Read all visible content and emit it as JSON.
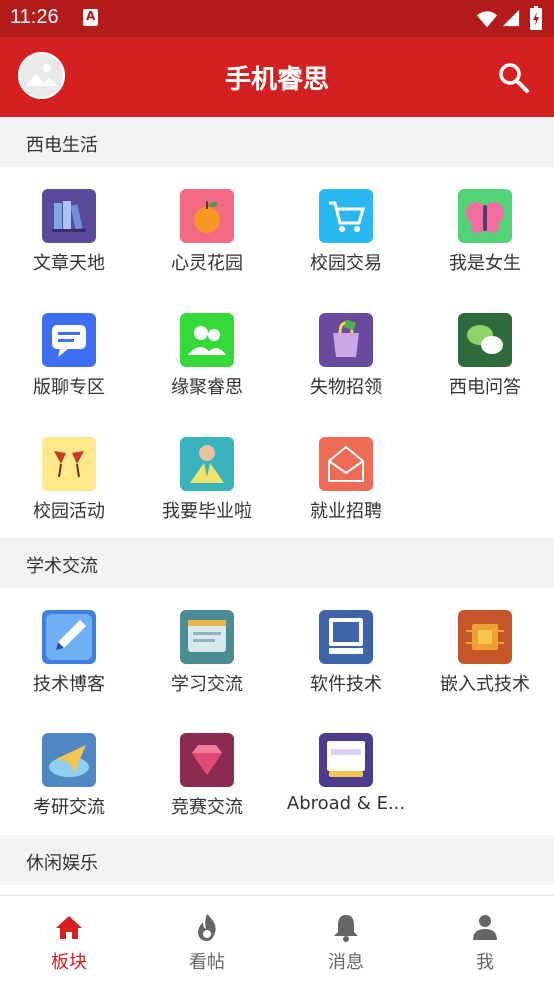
{
  "status_bar": {
    "time": "11:26"
  },
  "app_bar": {
    "title": "手机睿思"
  },
  "sections": [
    {
      "title": "西电生活",
      "items": [
        {
          "label": "文章天地",
          "icon": "bookshelf-icon",
          "color": "#5b4a9c"
        },
        {
          "label": "心灵花园",
          "icon": "apple-icon",
          "color": "#f26a83"
        },
        {
          "label": "校园交易",
          "icon": "shopping-cart-icon",
          "color": "#2bb8f0"
        },
        {
          "label": "我是女生",
          "icon": "butterfly-icon",
          "color": "#55d37a"
        },
        {
          "label": "版聊专区",
          "icon": "chat-bubble-icon",
          "color": "#3d6ff0"
        },
        {
          "label": "缘聚睿思",
          "icon": "people-icon",
          "color": "#36d93a"
        },
        {
          "label": "失物招领",
          "icon": "shopping-bag-icon",
          "color": "#6a4a9c"
        },
        {
          "label": "西电问答",
          "icon": "wechat-icon",
          "color": "#2e6b3a"
        },
        {
          "label": "校园活动",
          "icon": "cheers-icon",
          "color": "#fde98a"
        },
        {
          "label": "我要毕业啦",
          "icon": "graduate-icon",
          "color": "#3ab3bf"
        },
        {
          "label": "就业招聘",
          "icon": "envelope-icon",
          "color": "#ee6b55"
        }
      ]
    },
    {
      "title": "学术交流",
      "items": [
        {
          "label": "技术博客",
          "icon": "pencil-icon",
          "color": "#3f7fe0"
        },
        {
          "label": "学习交流",
          "icon": "browser-window-icon",
          "color": "#4a8c93"
        },
        {
          "label": "软件技术",
          "icon": "computer-icon",
          "color": "#3c64a7"
        },
        {
          "label": "嵌入式技术",
          "icon": "chip-icon",
          "color": "#c4562a"
        },
        {
          "label": "考研交流",
          "icon": "paper-plane-icon",
          "color": "#4f88c5"
        },
        {
          "label": "竞赛交流",
          "icon": "diamond-icon",
          "color": "#8c2a52"
        },
        {
          "label": "Abroad & E...",
          "icon": "english-book-icon",
          "color": "#4e3b8c"
        }
      ]
    },
    {
      "title": "休闲娱乐",
      "items": []
    }
  ],
  "bottom_nav": [
    {
      "label": "板块",
      "icon": "home-icon",
      "active": true
    },
    {
      "label": "看帖",
      "icon": "flame-icon",
      "active": false
    },
    {
      "label": "消息",
      "icon": "bell-icon",
      "active": false
    },
    {
      "label": "我",
      "icon": "person-icon",
      "active": false
    }
  ],
  "colors": {
    "primary": "#d42020",
    "status_bar": "#b41b1b",
    "section_bg": "#f2f2f2",
    "inactive_nav": "#666666"
  }
}
